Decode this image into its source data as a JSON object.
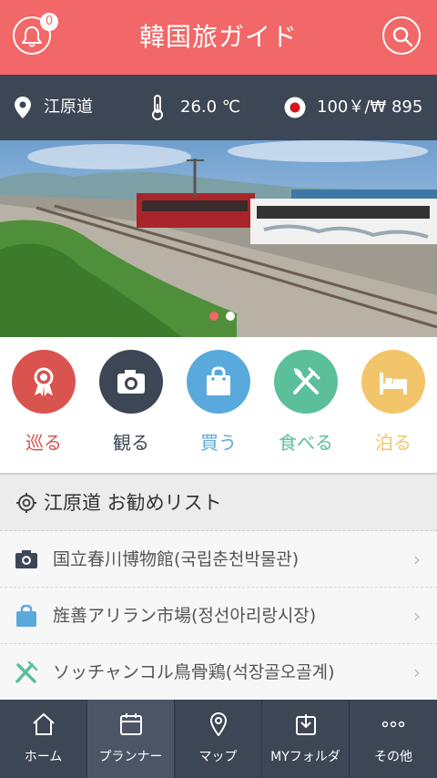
{
  "header": {
    "title": "韓国旅ガイド",
    "notification_count": "0"
  },
  "info_bar": {
    "region": "江原道",
    "temperature": "26.0 ℃",
    "exchange": "100￥/₩ 895"
  },
  "banner": {
    "active_slide": 1,
    "slide_count": 2
  },
  "categories": [
    {
      "label": "巡る",
      "color": "#d9534f"
    },
    {
      "label": "観る",
      "color": "#3c4654"
    },
    {
      "label": "買う",
      "color": "#5aa9dc"
    },
    {
      "label": "食べる",
      "color": "#5bbf9a"
    },
    {
      "label": "泊る",
      "color": "#f2c56b"
    }
  ],
  "recommend": {
    "title": "江原道 お勧めリスト",
    "items": [
      {
        "text": "国立春川博物館(국립춘천박물관)",
        "icon": "camera-icon"
      },
      {
        "text": "旌善アリラン市場(정선아리랑시장)",
        "icon": "shopping-bag-icon"
      },
      {
        "text": "ソッチャンコル鳥骨鶏(석장골오골계)",
        "icon": "fork-knife-icon"
      }
    ]
  },
  "nav": {
    "items": [
      {
        "label": "ホーム"
      },
      {
        "label": "プランナー"
      },
      {
        "label": "マップ"
      },
      {
        "label": "MYフォルダ"
      },
      {
        "label": "その他"
      }
    ]
  }
}
